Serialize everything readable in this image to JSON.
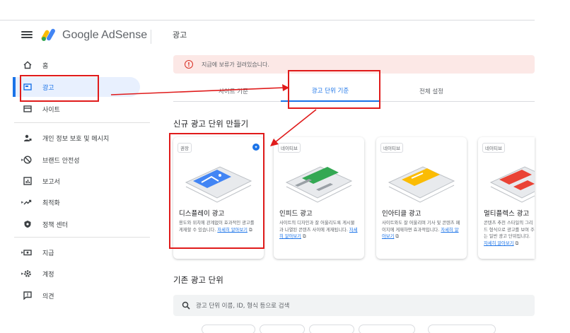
{
  "app": {
    "logo_text": "Google AdSense"
  },
  "sidebar": {
    "items": [
      {
        "label": "홈",
        "icon": "home-icon"
      },
      {
        "label": "광고",
        "icon": "ads-icon"
      },
      {
        "label": "사이트",
        "icon": "sites-icon"
      },
      {
        "label": "개인 정보 보호 및 메시지",
        "icon": "privacy-icon"
      },
      {
        "label": "브랜드 안전성",
        "icon": "block-icon"
      },
      {
        "label": "보고서",
        "icon": "reports-icon"
      },
      {
        "label": "최적화",
        "icon": "trending-icon"
      },
      {
        "label": "정책 센터",
        "icon": "policy-icon"
      },
      {
        "label": "지급",
        "icon": "payments-icon"
      },
      {
        "label": "계정",
        "icon": "gear-icon"
      },
      {
        "label": "의견",
        "icon": "feedback-icon"
      }
    ]
  },
  "header": {
    "title": "광고"
  },
  "alert": {
    "text": "지급에 보류가 걸려있습니다."
  },
  "tabs": [
    {
      "label": "사이트 기준"
    },
    {
      "label": "광고 단위 기준"
    },
    {
      "label": "전체 설정"
    }
  ],
  "new_section_title": "신규 광고 단위 만들기",
  "cards": [
    {
      "tag": "권장",
      "title": "디스플레이 광고",
      "desc": "용도와 위치에 관계없이 효과적인 광고를 게재할 수 있습니다.",
      "link": "자세히 알아보기",
      "accent": "#4285f4"
    },
    {
      "tag": "네이티브",
      "title": "인피드 광고",
      "desc": "사이트의 디자인과 잘 어울리도록 게시물과 나열된 콘텐츠 사이에 게재됩니다.",
      "link": "자세히 알아보기",
      "accent": "#34a853"
    },
    {
      "tag": "네이티브",
      "title": "인아티클 광고",
      "desc": "사이트와도 잘 어울리며 기사 및 콘텐츠 페이지에 게재하면 효과적입니다.",
      "link": "자세히 알아보기",
      "accent": "#fbbc04"
    },
    {
      "tag": "네이티브",
      "title": "멀티플렉스 광고",
      "desc": "콘텐츠 추천 스타일의 그리드 형식으로 광고를 보여 주는 일반 광고 단위입니다.",
      "link": "자세히 알아보기",
      "accent": "#ea4335"
    }
  ],
  "existing_section_title": "기존 광고 단위",
  "search": {
    "placeholder": "광고 단위 이름, ID, 형식 등으로 검색"
  }
}
